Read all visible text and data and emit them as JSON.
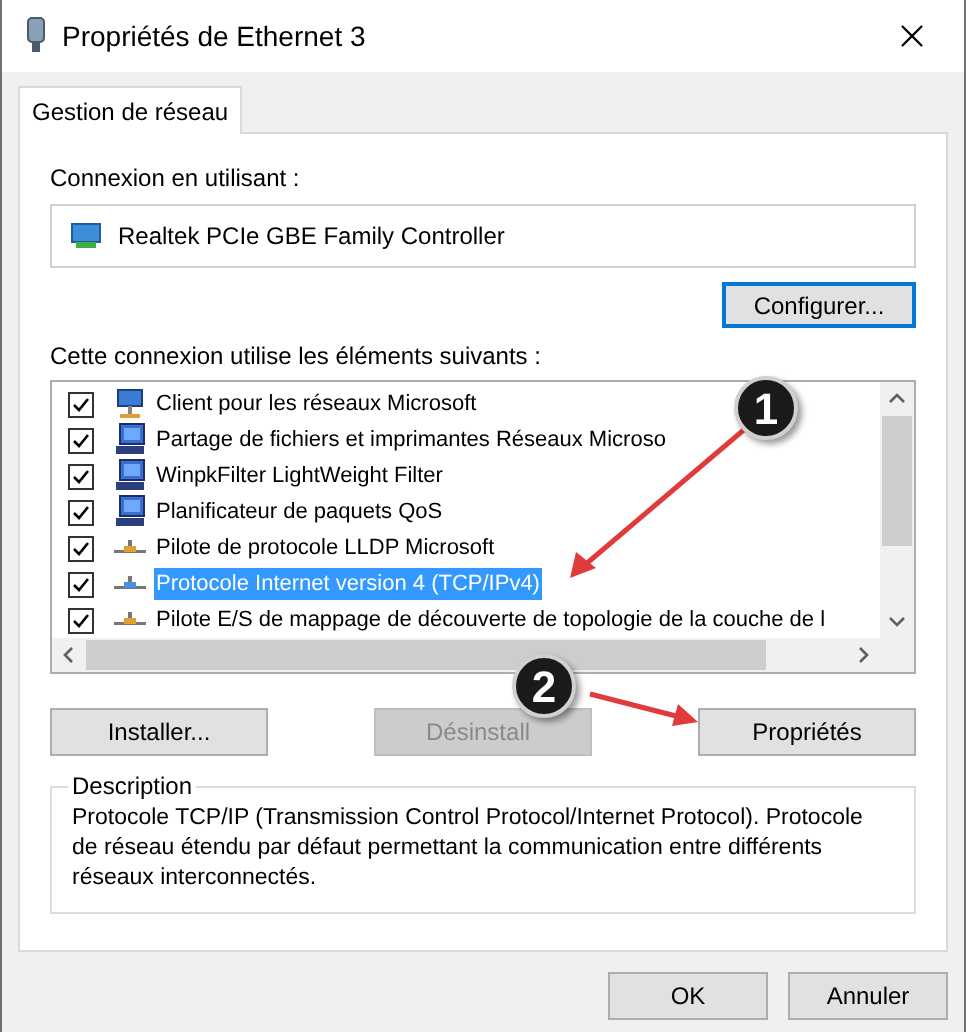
{
  "window": {
    "title": "Propriétés de Ethernet 3"
  },
  "tabs": [
    {
      "label": "Gestion de réseau",
      "selected": true
    }
  ],
  "connection_label": "Connexion en utilisant :",
  "adapter": "Realtek PCIe GBE Family Controller",
  "configure_button": "Configurer...",
  "items_label": "Cette connexion utilise les éléments suivants :",
  "items": [
    {
      "label": "Client pour les réseaux Microsoft",
      "checked": true,
      "selected": false,
      "kind": "client"
    },
    {
      "label": "Partage de fichiers et imprimantes Réseaux Microso",
      "checked": true,
      "selected": false,
      "kind": "service"
    },
    {
      "label": "WinpkFilter LightWeight Filter",
      "checked": true,
      "selected": false,
      "kind": "service"
    },
    {
      "label": "Planificateur de paquets QoS",
      "checked": true,
      "selected": false,
      "kind": "service"
    },
    {
      "label": "Pilote de protocole LLDP Microsoft",
      "checked": true,
      "selected": false,
      "kind": "protocol"
    },
    {
      "label": "Protocole Internet version 4 (TCP/IPv4)",
      "checked": true,
      "selected": true,
      "kind": "protocol"
    },
    {
      "label": "Pilote E/S de mappage de découverte de topologie de la couche de l",
      "checked": true,
      "selected": false,
      "kind": "protocol"
    }
  ],
  "buttons": [
    {
      "label": "Installer...",
      "disabled": false
    },
    {
      "label": "Désinstall",
      "disabled": true
    },
    {
      "label": "Propriétés",
      "disabled": false
    }
  ],
  "description": {
    "title": "Description",
    "text": "Protocole TCP/IP (Transmission Control Protocol/Internet Protocol). Protocole de réseau étendu par défaut permettant la communication entre différents réseaux interconnectés."
  },
  "footer_buttons": [
    {
      "label": "OK"
    },
    {
      "label": "Annuler"
    }
  ],
  "annotations": [
    {
      "number": "1"
    },
    {
      "number": "2"
    }
  ]
}
